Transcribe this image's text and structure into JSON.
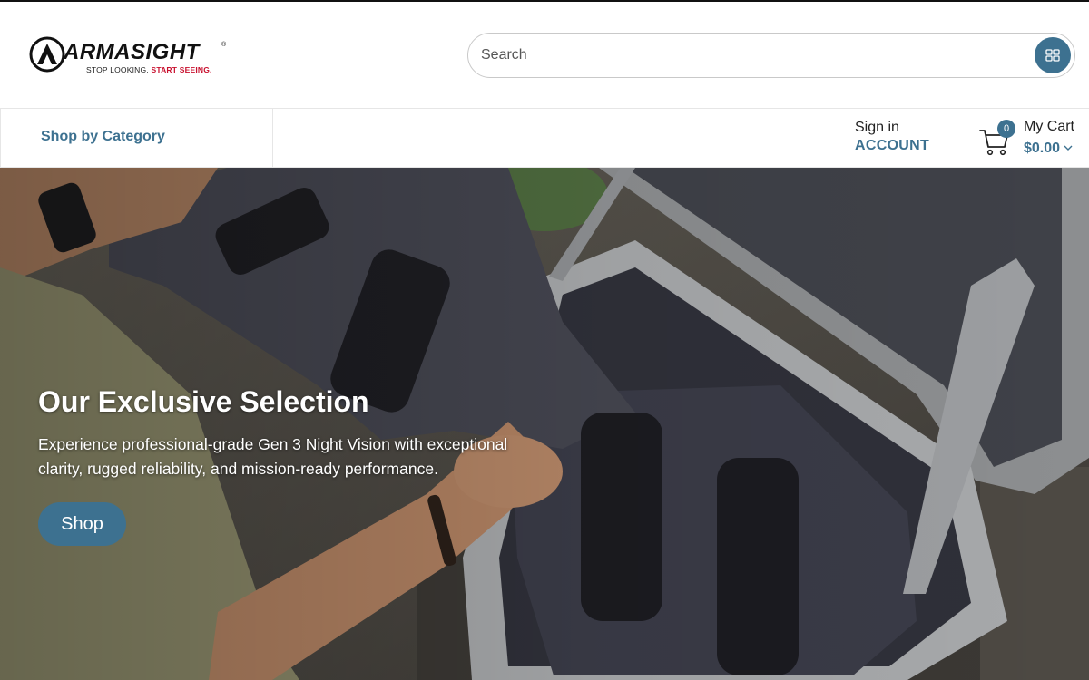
{
  "brand": {
    "name": "ARMASIGHT",
    "tagline_prefix": "STOP LOOKING.",
    "tagline_accent": "START SEEING.",
    "trademark": "®",
    "accent_color": "#3d7190",
    "tag_color": "#c8102e"
  },
  "search": {
    "placeholder": "Search",
    "button_icon": "grid-icon"
  },
  "nav": {
    "shop_by_category": "Shop by Category",
    "sign_in": "Sign in",
    "account": "ACCOUNT"
  },
  "cart": {
    "icon": "cart-icon",
    "count": "0",
    "title": "My Cart",
    "total": "$0.00"
  },
  "hero": {
    "title": "Our Exclusive Selection",
    "description": "Experience professional-grade Gen 3 Night Vision with exceptional clarity, rugged reliability, and mission-ready performance.",
    "button_label": "Shop"
  }
}
